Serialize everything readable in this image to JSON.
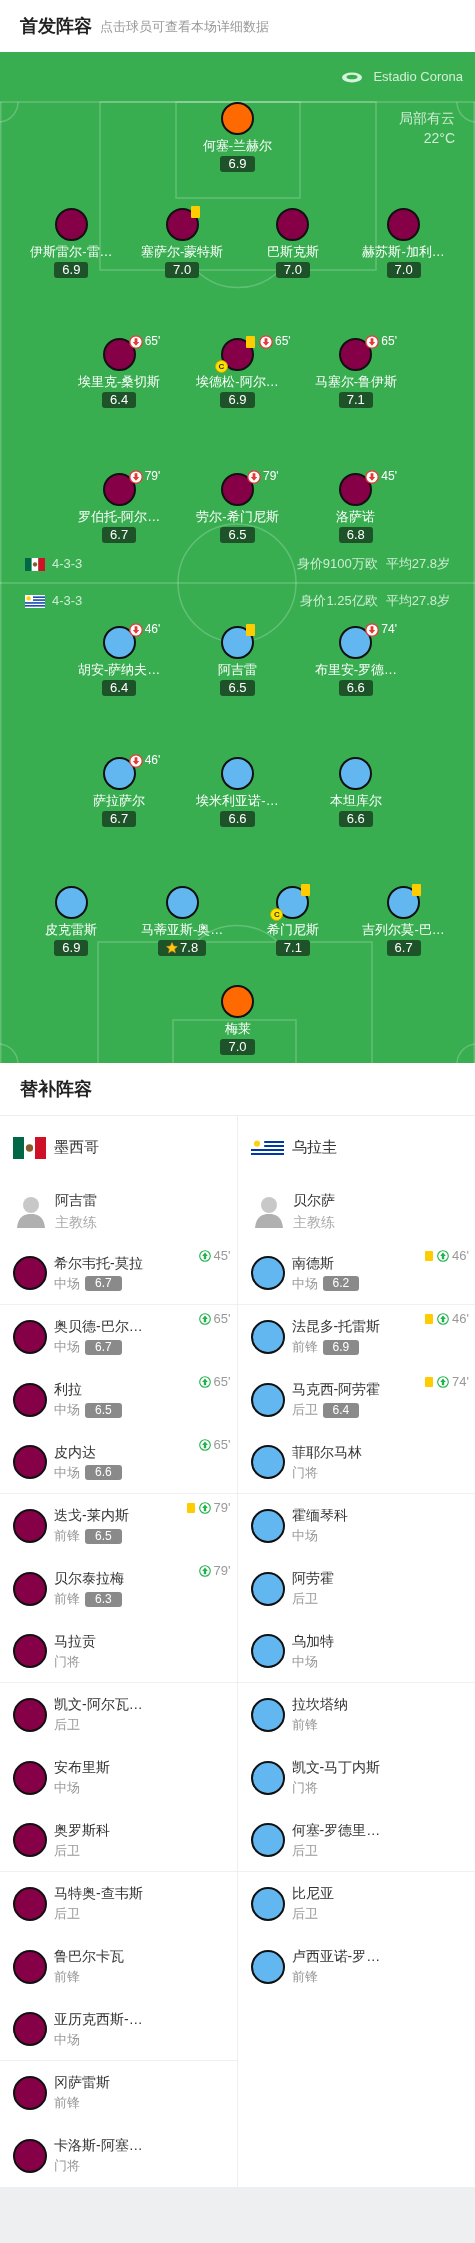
{
  "header": {
    "title": "首发阵容",
    "subtitle": "点击球员可查看本场详细数据"
  },
  "pitch": {
    "stadium": "Estadio Corona",
    "weather": "局部有云",
    "temperature": "22°C",
    "teams": [
      {
        "kind": "mexico",
        "formation": "4-3-3",
        "value": "身价9100万欧",
        "average_age": "平均27.8岁",
        "lines": [
          {
            "color": "#ff6a00",
            "players": [
              {
                "name": "何塞-兰赫尔",
                "rating": "6.9",
                "yellow_card": false,
                "motm": false
              }
            ]
          },
          {
            "color": "#850046",
            "players": [
              {
                "name": "伊斯雷尔-雷…",
                "rating": "6.9",
                "yellow_card": false,
                "motm": false
              },
              {
                "name": "塞萨尔-蒙特斯",
                "rating": "7.0",
                "yellow_card": true,
                "motm": false
              },
              {
                "name": "巴斯克斯",
                "rating": "7.0",
                "yellow_card": false,
                "motm": false
              },
              {
                "name": "赫苏斯-加利…",
                "rating": "7.0",
                "yellow_card": false,
                "motm": false
              }
            ]
          },
          {
            "color": "#850046",
            "players": [
              {
                "name": "埃里克-桑切斯",
                "rating": "6.4",
                "yellow_card": false,
                "motm": false,
                "sub_out": "65'"
              },
              {
                "name": "埃德松-阿尔…",
                "rating": "6.9",
                "yellow_card": true,
                "motm": false,
                "sub_out": "65'",
                "captain_badge": "C"
              },
              {
                "name": "马塞尔-鲁伊斯",
                "rating": "7.1",
                "yellow_card": false,
                "motm": false,
                "sub_out": "65'"
              }
            ]
          },
          {
            "color": "#850046",
            "players": [
              {
                "name": "罗伯托-阿尔…",
                "rating": "6.7",
                "yellow_card": false,
                "motm": false,
                "sub_out": "79'"
              },
              {
                "name": "劳尔-希门尼斯",
                "rating": "6.5",
                "yellow_card": false,
                "motm": false,
                "sub_out": "79'"
              },
              {
                "name": "洛萨诺",
                "rating": "6.8",
                "yellow_card": false,
                "motm": false,
                "sub_out": "45'"
              }
            ]
          }
        ]
      },
      {
        "kind": "uruguay",
        "formation": "4-3-3",
        "value": "身价1.25亿欧",
        "average_age": "平均27.8岁",
        "lines": [
          {
            "color": "#63b7f1",
            "players": [
              {
                "name": "胡安-萨纳夫…",
                "rating": "6.4",
                "yellow_card": false,
                "motm": false,
                "sub_out": "46'"
              },
              {
                "name": "阿吉雷",
                "rating": "6.5",
                "yellow_card": true,
                "motm": false
              },
              {
                "name": "布里安-罗德…",
                "rating": "6.6",
                "yellow_card": false,
                "motm": false,
                "sub_out": "74'"
              }
            ]
          },
          {
            "color": "#63b7f1",
            "players": [
              {
                "name": "萨拉萨尔",
                "rating": "6.7",
                "yellow_card": false,
                "motm": false,
                "sub_out": "46'"
              },
              {
                "name": "埃米利亚诺-…",
                "rating": "6.6",
                "yellow_card": false,
                "motm": false
              },
              {
                "name": "本坦库尔",
                "rating": "6.6",
                "yellow_card": false,
                "motm": false
              }
            ]
          },
          {
            "color": "#63b7f1",
            "players": [
              {
                "name": "皮克雷斯",
                "rating": "6.9",
                "yellow_card": false,
                "motm": false
              },
              {
                "name": "马蒂亚斯-奥…",
                "rating": "7.8",
                "yellow_card": false,
                "motm": true
              },
              {
                "name": "希门尼斯",
                "rating": "7.1",
                "yellow_card": true,
                "motm": false,
                "captain_badge": "C"
              },
              {
                "name": "吉列尔莫-巴…",
                "rating": "6.7",
                "yellow_card": true,
                "motm": false
              }
            ]
          },
          {
            "color": "#ff6a00",
            "players": [
              {
                "name": "梅莱",
                "rating": "7.0",
                "yellow_card": false,
                "motm": false
              }
            ]
          }
        ]
      }
    ]
  },
  "substitutes": {
    "title": "替补阵容",
    "teams": [
      {
        "kind": "mexico",
        "name": "墨西哥",
        "color": "#850046",
        "coach": {
          "name": "阿吉雷",
          "role": "主教练"
        },
        "players": [
          {
            "name": "希尔韦托-莫拉",
            "position": "中场",
            "rating": "6.7",
            "yellow_card": false,
            "sub_in": "45'",
            "divider_below": true
          },
          {
            "name": "奥贝德-巴尔…",
            "position": "中场",
            "rating": "6.7",
            "yellow_card": false,
            "sub_in": "65'",
            "divider_below": false
          },
          {
            "name": "利拉",
            "position": "中场",
            "rating": "6.5",
            "yellow_card": false,
            "sub_in": "65'",
            "divider_below": false
          },
          {
            "name": "皮内达",
            "position": "中场",
            "rating": "6.6",
            "yellow_card": false,
            "sub_in": "65'",
            "divider_below": true
          },
          {
            "name": "迭戈-莱内斯",
            "position": "前锋",
            "rating": "6.5",
            "yellow_card": true,
            "sub_in": "79'",
            "divider_below": false
          },
          {
            "name": "贝尔泰拉梅",
            "position": "前锋",
            "rating": "6.3",
            "yellow_card": false,
            "sub_in": "79'",
            "divider_below": false
          },
          {
            "name": "马拉贡",
            "position": "门将",
            "yellow_card": false,
            "divider_below": true
          },
          {
            "name": "凯文-阿尔瓦…",
            "position": "后卫",
            "yellow_card": false,
            "divider_below": false
          },
          {
            "name": "安布里斯",
            "position": "中场",
            "yellow_card": false,
            "divider_below": false
          },
          {
            "name": "奥罗斯科",
            "position": "后卫",
            "yellow_card": false,
            "divider_below": true
          },
          {
            "name": "马特奥-查韦斯",
            "position": "后卫",
            "yellow_card": false,
            "divider_below": false
          },
          {
            "name": "鲁巴尔卡瓦",
            "position": "前锋",
            "yellow_card": false,
            "divider_below": false
          },
          {
            "name": "亚历克西斯-…",
            "position": "中场",
            "yellow_card": false,
            "divider_below": true
          },
          {
            "name": "冈萨雷斯",
            "position": "前锋",
            "yellow_card": false,
            "divider_below": false
          },
          {
            "name": "卡洛斯-阿塞…",
            "position": "门将",
            "yellow_card": false,
            "divider_below": false
          }
        ]
      },
      {
        "kind": "uruguay",
        "name": "乌拉圭",
        "color": "#63b7f1",
        "coach": {
          "name": "贝尔萨",
          "role": "主教练"
        },
        "players": [
          {
            "name": "南德斯",
            "position": "中场",
            "rating": "6.2",
            "yellow_card": true,
            "sub_in": "46'",
            "divider_below": true
          },
          {
            "name": "法昆多-托雷斯",
            "position": "前锋",
            "rating": "6.9",
            "yellow_card": true,
            "sub_in": "46'",
            "divider_below": false
          },
          {
            "name": "马克西-阿劳霍",
            "position": "后卫",
            "rating": "6.4",
            "yellow_card": true,
            "sub_in": "74'",
            "divider_below": false
          },
          {
            "name": "菲耶尔马林",
            "position": "门将",
            "yellow_card": false,
            "divider_below": true
          },
          {
            "name": "霍缅琴科",
            "position": "中场",
            "yellow_card": false,
            "divider_below": false
          },
          {
            "name": "阿劳霍",
            "position": "后卫",
            "yellow_card": false,
            "divider_below": false
          },
          {
            "name": "乌加特",
            "position": "中场",
            "yellow_card": false,
            "divider_below": true
          },
          {
            "name": "拉坎塔纳",
            "position": "前锋",
            "yellow_card": false,
            "divider_below": false
          },
          {
            "name": "凯文-马丁内斯",
            "position": "门将",
            "yellow_card": false,
            "divider_below": false
          },
          {
            "name": "何塞-罗德里…",
            "position": "后卫",
            "yellow_card": false,
            "divider_below": true
          },
          {
            "name": "比尼亚",
            "position": "后卫",
            "yellow_card": false,
            "divider_below": false
          },
          {
            "name": "卢西亚诺-罗…",
            "position": "前锋",
            "yellow_card": false,
            "divider_below": false
          }
        ]
      }
    ]
  }
}
